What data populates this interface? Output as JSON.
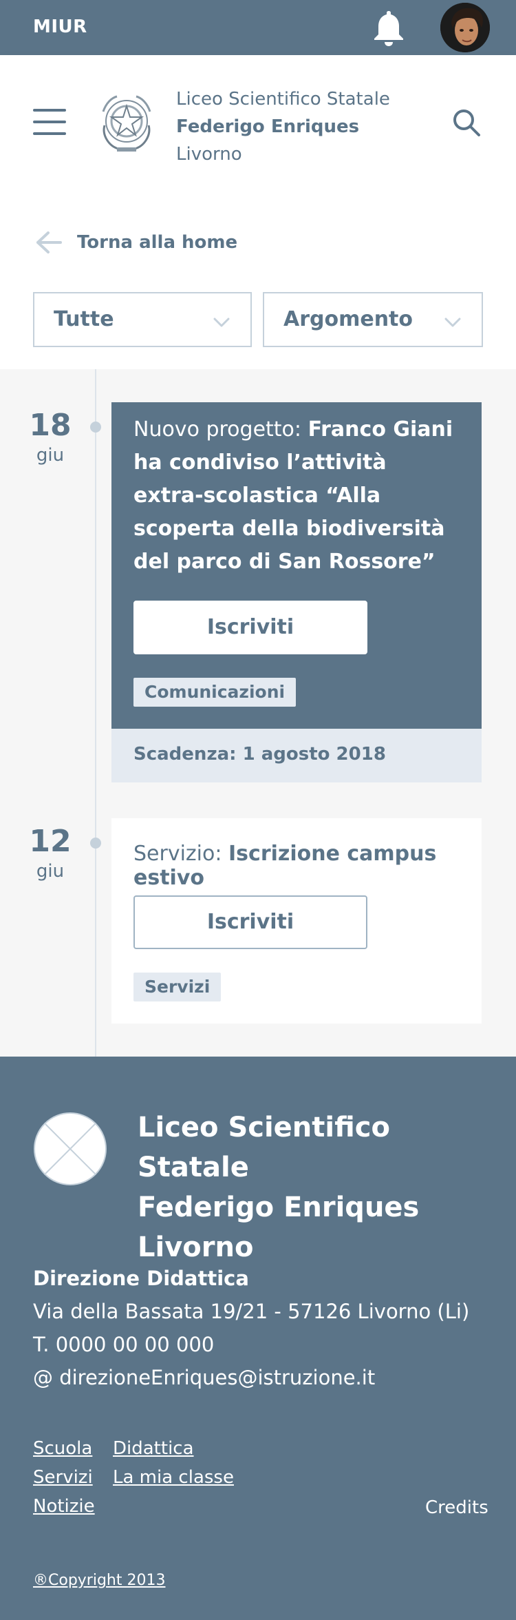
{
  "topbar": {
    "brand": "MIUR",
    "bell_icon": "bell-icon",
    "avatar": "user-avatar"
  },
  "header": {
    "menu_icon": "hamburger-menu-icon",
    "emblem": "italian-republic-emblem",
    "school_line1": "Liceo Scientifico Statale",
    "school_line2": "Federigo Enriques",
    "school_line3": "Livorno",
    "search_icon": "search-icon"
  },
  "nav": {
    "back_label": "Torna alla home",
    "back_icon": "arrow-left-icon"
  },
  "filters": {
    "filter1_value": "Tutte",
    "filter2_value": "Argomento"
  },
  "timeline": [
    {
      "day": "18",
      "month": "giu",
      "prefix": "Nuovo progetto: ",
      "title": "Franco Giani ha condiviso l’attività extra-scolastica “Alla scoperta della biodiversità del parco di San Rossore”",
      "button": "Iscriviti",
      "tag": "Comunicazioni",
      "deadline": "Scadenza: 1 agosto 2018"
    },
    {
      "day": "12",
      "month": "giu",
      "prefix": "Servizio: ",
      "title": "Iscrizione campus estivo",
      "button": "Iscriviti",
      "tag": "Servizi"
    }
  ],
  "footer": {
    "title_line1": "Liceo Scientifico Statale",
    "title_line2": "Federigo Enriques",
    "title_line3": "Livorno",
    "contact_head": "Direzione Didattica",
    "address": "Via della Bassata 19/21 - 57126 Livorno (Li)",
    "phone": "T. 0000 00 00 000",
    "email": "@ direzioneEnriques@istruzione.it",
    "links": [
      "Scuola",
      "Didattica",
      "Servizi",
      "La mia classe",
      "Notizie"
    ],
    "credits": "Credits",
    "copyright": "®Copyright 2013"
  },
  "colors": {
    "primary": "#5b7488",
    "light": "#e4eaf1",
    "white": "#ffffff"
  }
}
